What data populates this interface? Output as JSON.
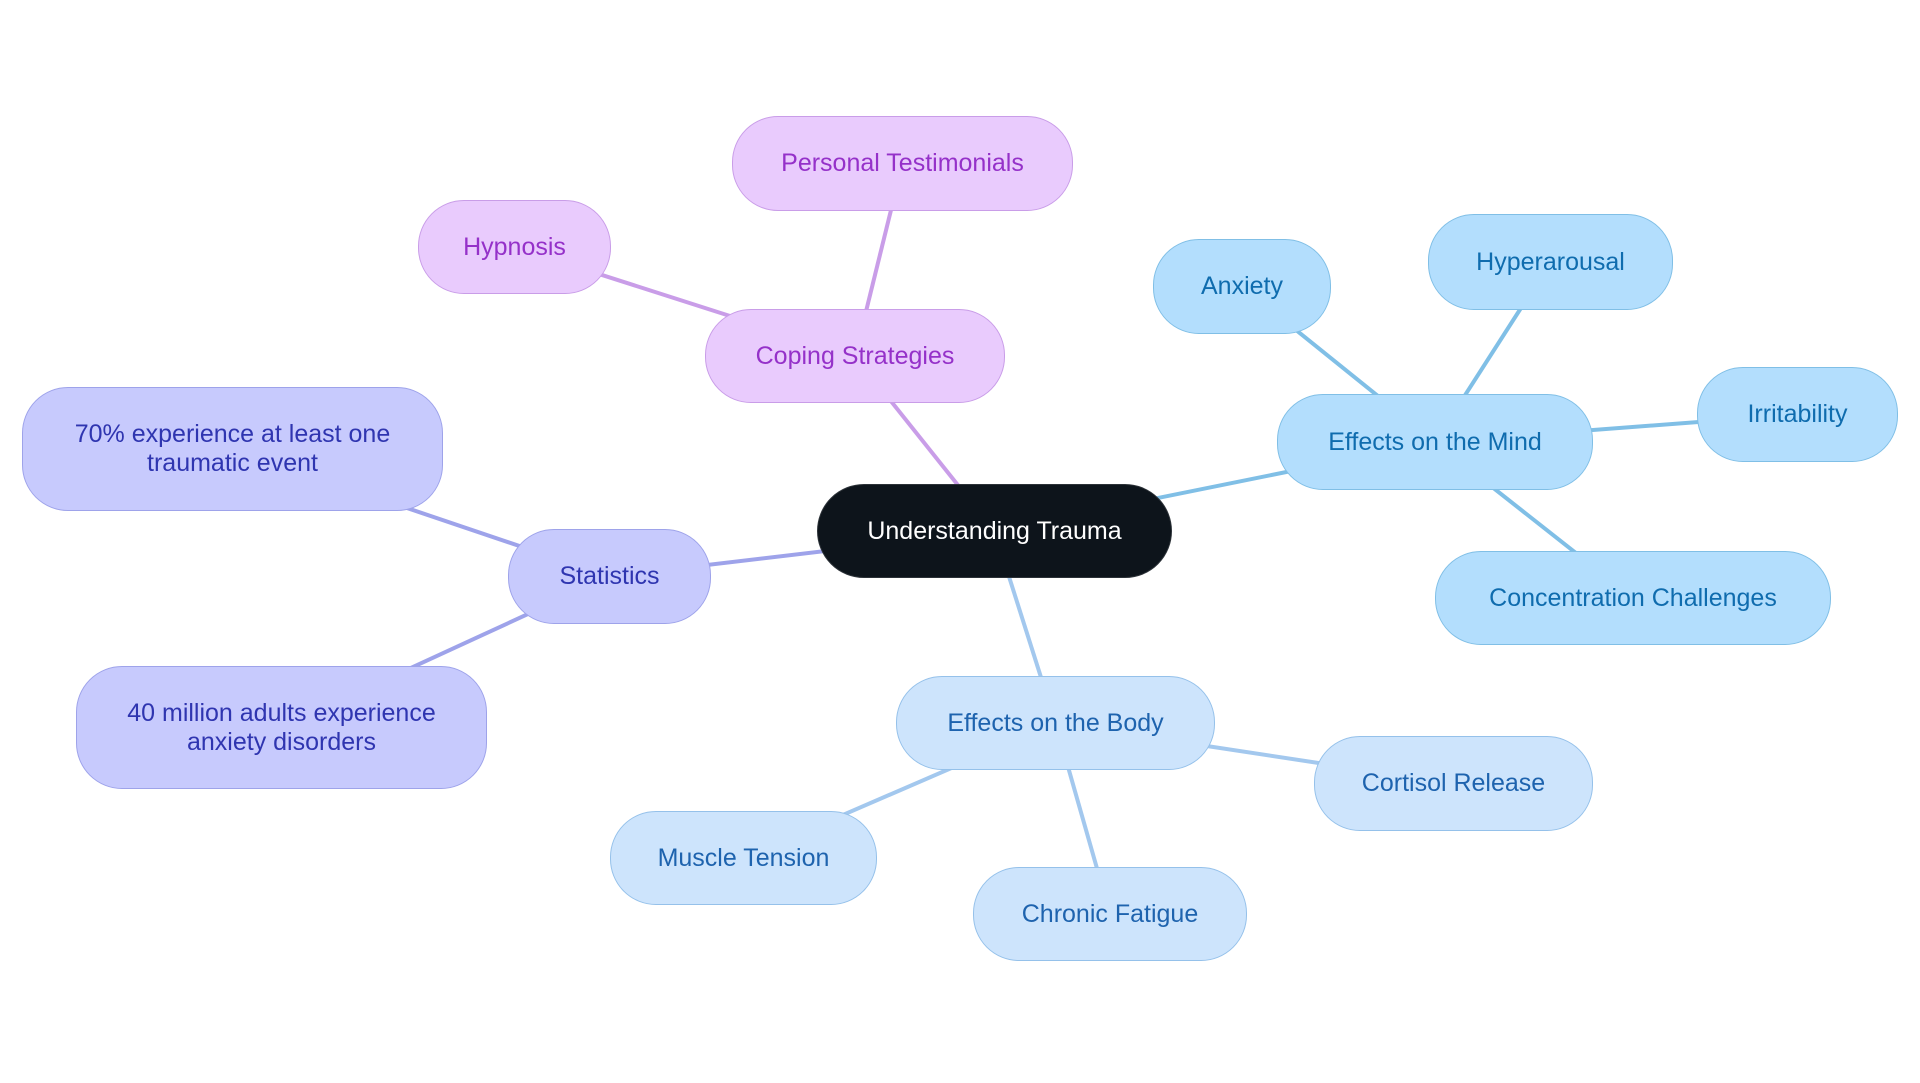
{
  "title": "Understanding Trauma",
  "colors": {
    "coping_edge": "#c99de8",
    "stats_edge": "#9ea3ea",
    "mind_edge": "#80bfe6",
    "body_edge": "#a3c8ee"
  },
  "root": {
    "id": "root",
    "label": "Understanding Trauma"
  },
  "branches": [
    {
      "id": "coping",
      "label": "Coping Strategies",
      "color_key": "coping_edge",
      "children": [
        {
          "id": "testimonials",
          "label": "Personal Testimonials"
        },
        {
          "id": "hypnosis",
          "label": "Hypnosis"
        }
      ]
    },
    {
      "id": "stats",
      "label": "Statistics",
      "color_key": "stats_edge",
      "children": [
        {
          "id": "stat70",
          "label": "70% experience at least one traumatic event"
        },
        {
          "id": "stat40",
          "label": "40 million adults experience anxiety disorders"
        }
      ]
    },
    {
      "id": "mind",
      "label": "Effects on the Mind",
      "color_key": "mind_edge",
      "children": [
        {
          "id": "anxiety",
          "label": "Anxiety"
        },
        {
          "id": "hyperarousal",
          "label": "Hyperarousal"
        },
        {
          "id": "irritability",
          "label": "Irritability"
        },
        {
          "id": "concentration",
          "label": "Concentration Challenges"
        }
      ]
    },
    {
      "id": "body",
      "label": "Effects on the Body",
      "color_key": "body_edge",
      "children": [
        {
          "id": "cortisol",
          "label": "Cortisol Release"
        },
        {
          "id": "muscle",
          "label": "Muscle Tension"
        },
        {
          "id": "fatigue",
          "label": "Chronic Fatigue"
        }
      ]
    }
  ]
}
